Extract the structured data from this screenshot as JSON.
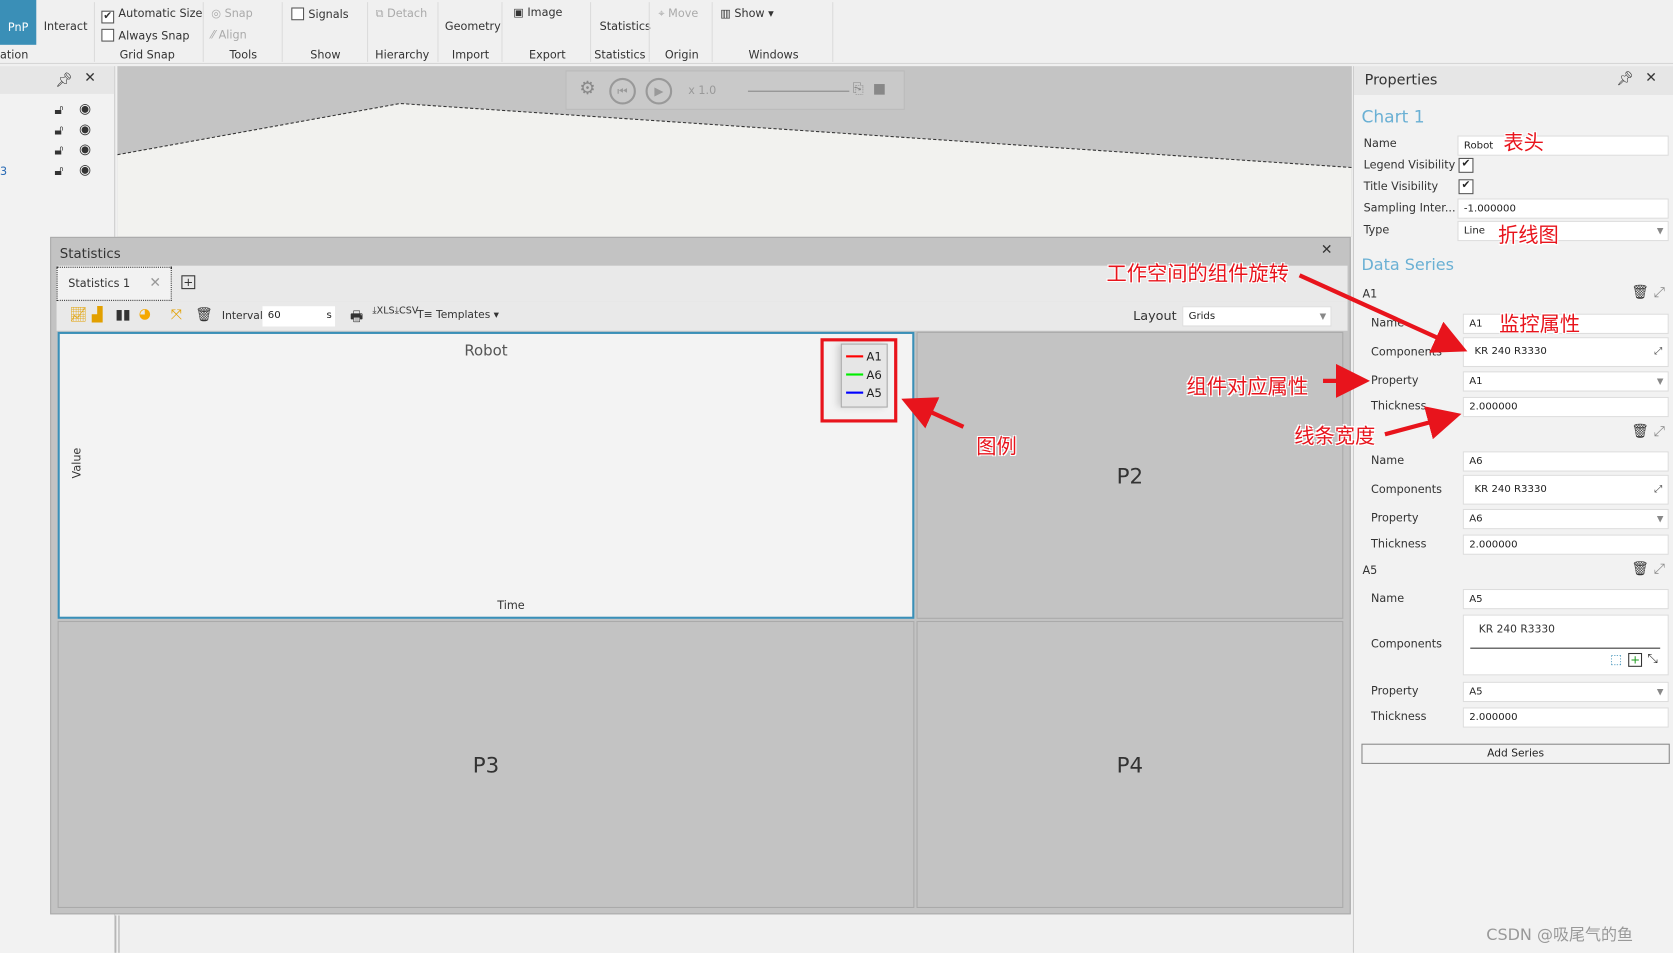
{
  "ribbon": {
    "pnp": "PnP",
    "interact": "Interact",
    "automatic_size": "Automatic Size",
    "always_snap": "Always Snap",
    "snap": "Snap",
    "align": "Align",
    "signals": "Signals",
    "detach": "Detach",
    "geometry": "Geometry",
    "image": "Image",
    "statistics": "Statistics",
    "move": "Move",
    "show": "Show ▾",
    "groups": [
      "ation",
      "Grid Snap",
      "Tools",
      "Show",
      "Hierarchy",
      "Import",
      "Export",
      "Statistics",
      "Origin",
      "Windows"
    ]
  },
  "left_panel": {
    "partial_item": "3"
  },
  "playback": {
    "speed": "x 1.0"
  },
  "statistics_window": {
    "title": "Statistics",
    "tab": "Statistics 1",
    "interval_label": "Interval",
    "interval_value": "60",
    "interval_unit": "s",
    "templates": "Templates ▾",
    "layout_label": "Layout",
    "layout_value": "Grids",
    "chart": {
      "title": "Robot",
      "ylabel": "Value",
      "xlabel": "Time",
      "legend": [
        {
          "name": "A1",
          "color": "#ff0000"
        },
        {
          "name": "A6",
          "color": "#00e000"
        },
        {
          "name": "A5",
          "color": "#0000ff"
        }
      ]
    },
    "panels": [
      "P2",
      "P3",
      "P4"
    ]
  },
  "properties": {
    "title": "Properties",
    "chart_name": "Chart 1",
    "name_label": "Name",
    "name_value": "Robot",
    "legend_label": "Legend Visibility",
    "legend_checked": true,
    "title_vis_label": "Title Visibility",
    "title_checked": true,
    "sampling_label": "Sampling Inter...",
    "sampling_value": "-1.000000",
    "type_label": "Type",
    "type_value": "Line",
    "data_series_heading": "Data Series",
    "labels": {
      "name": "Name",
      "components": "Components",
      "property": "Property",
      "thickness": "Thickness"
    },
    "series": [
      {
        "header": "A1",
        "name": "A1",
        "components": "KR 240 R3330",
        "property": "A1",
        "thickness": "2.000000"
      },
      {
        "header": "",
        "name": "A6",
        "components": "KR 240 R3330",
        "property": "A6",
        "thickness": "2.000000"
      },
      {
        "header": "A5",
        "name": "A5",
        "components": "KR 240 R3330",
        "property": "A5",
        "thickness": "2.000000"
      }
    ],
    "add_series": "Add Series"
  },
  "annotations": {
    "header": "表头",
    "line_chart": "折线图",
    "component_rotation": "工作空间的组件旋转",
    "monitor_property": "监控属性",
    "component_property": "组件对应属性",
    "line_width": "线条宽度",
    "legend": "图例",
    "color": "#e8141c"
  },
  "watermark": "CSDN @吸尾气的鱼"
}
